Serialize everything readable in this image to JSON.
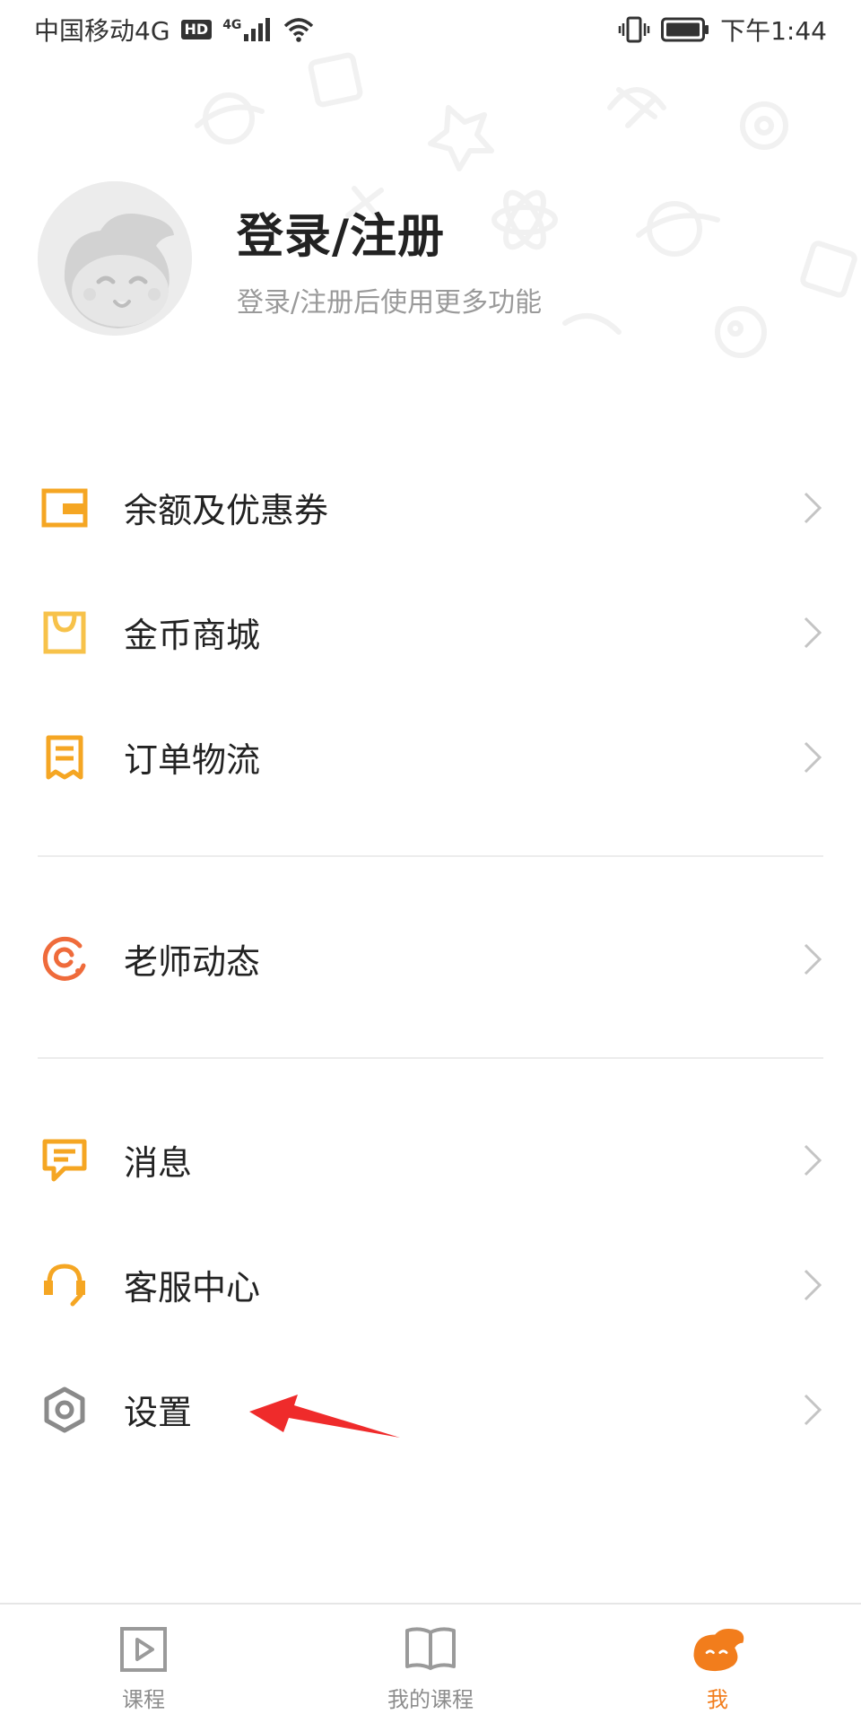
{
  "status_bar": {
    "carrier": "中国移动4G",
    "hd": "HD",
    "network": "4G",
    "time": "下午1:44"
  },
  "profile": {
    "title": "登录/注册",
    "subtitle": "登录/注册后使用更多功能"
  },
  "menu": {
    "group1": [
      {
        "label": "余额及优惠券",
        "icon": "wallet-icon",
        "color": "#f5a623"
      },
      {
        "label": "金币商城",
        "icon": "shopping-bag-icon",
        "color": "#f7c24a"
      },
      {
        "label": "订单物流",
        "icon": "receipt-icon",
        "color": "#f5a623"
      }
    ],
    "group2": [
      {
        "label": "老师动态",
        "icon": "teacher-feed-icon",
        "color": "#ef6b3b"
      }
    ],
    "group3": [
      {
        "label": "消息",
        "icon": "message-icon",
        "color": "#f5a623"
      },
      {
        "label": "客服中心",
        "icon": "headset-icon",
        "color": "#f5a623"
      },
      {
        "label": "设置",
        "icon": "settings-icon",
        "color": "#8a8a8a"
      }
    ]
  },
  "bottom_nav": {
    "items": [
      {
        "label": "课程",
        "icon": "play-icon"
      },
      {
        "label": "我的课程",
        "icon": "book-icon"
      },
      {
        "label": "我",
        "icon": "profile-mascot-icon",
        "active": true
      }
    ]
  },
  "colors": {
    "accent": "#f27d1c",
    "annotation_arrow": "#ef2b2b"
  }
}
